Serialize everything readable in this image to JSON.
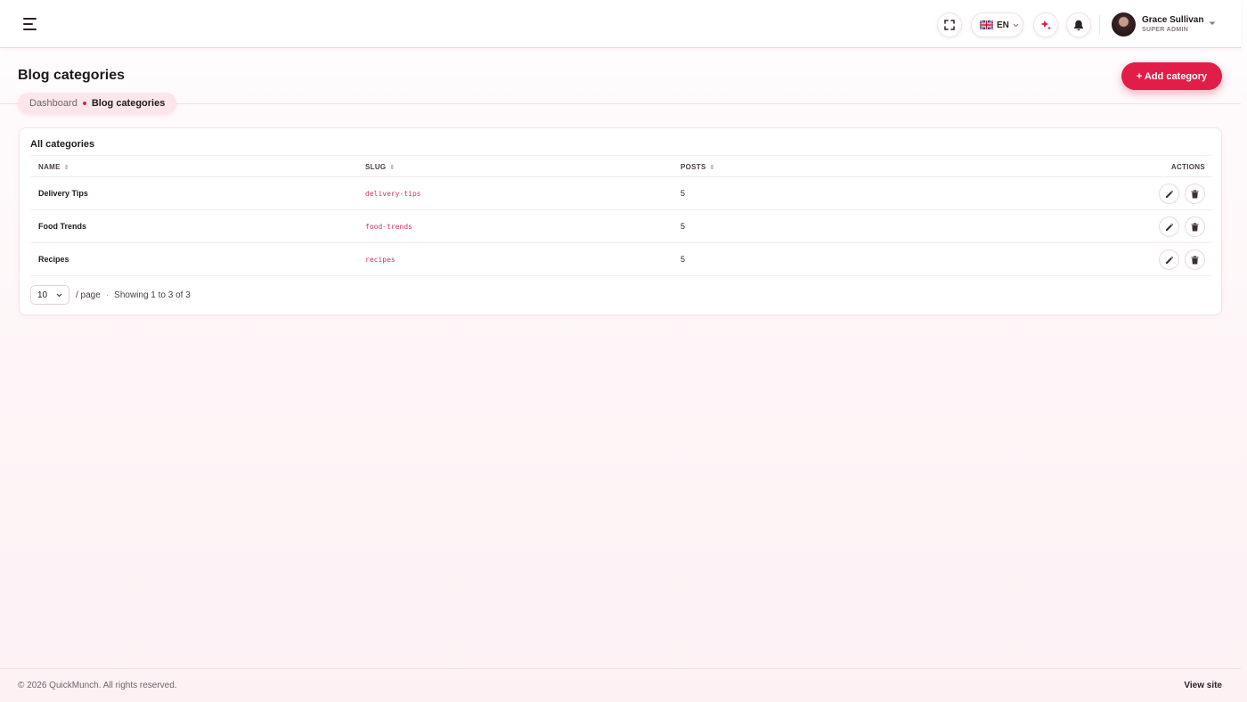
{
  "header": {
    "language_code": "EN",
    "user": {
      "name": "Grace Sullivan",
      "role": "SUPER ADMIN"
    }
  },
  "page": {
    "title": "Blog categories",
    "add_button_label": "+ Add category",
    "breadcrumb": {
      "parent": "Dashboard",
      "current": "Blog categories"
    }
  },
  "table": {
    "card_title": "All categories",
    "columns": {
      "name": "NAME",
      "slug": "SLUG",
      "posts": "POSTS",
      "actions": "ACTIONS"
    },
    "rows": [
      {
        "name": "Delivery Tips",
        "slug": "delivery-tips",
        "posts": "5"
      },
      {
        "name": "Food Trends",
        "slug": "food-trends",
        "posts": "5"
      },
      {
        "name": "Recipes",
        "slug": "recipes",
        "posts": "5"
      }
    ]
  },
  "pagination": {
    "page_size": "10",
    "per_page_label": "/ page",
    "separator": "·",
    "summary": "Showing 1 to 3 of 3"
  },
  "footer": {
    "copyright": "© 2026 QuickMunch. All rights reserved.",
    "view_site": "View site"
  },
  "colors": {
    "accent": "#e11d48",
    "slug_text": "#d6336c"
  },
  "icons": {
    "menu": "hamburger-menu-icon",
    "fullscreen": "fullscreen-icon",
    "flag": "uk-flag-icon",
    "ai": "sparkle-icon",
    "notifications": "bell-icon",
    "edit": "pencil-icon",
    "delete": "trash-icon"
  }
}
